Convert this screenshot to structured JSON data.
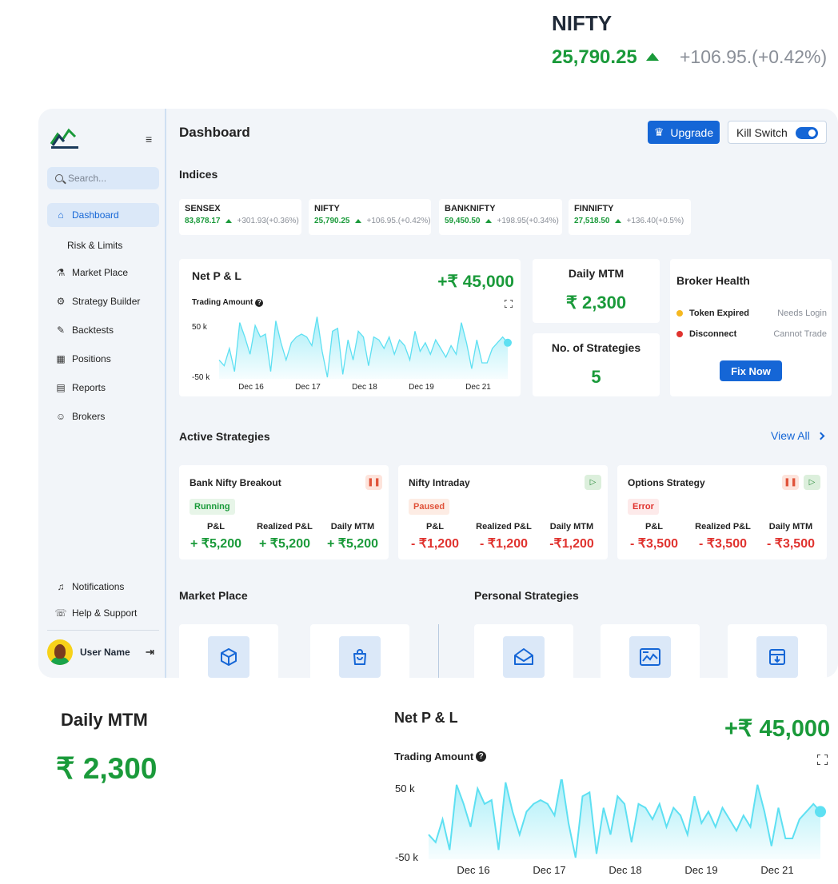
{
  "float_nifty": {
    "title": "NIFTY",
    "value": "25,790.25",
    "change": "+106.95.(+0.42%)"
  },
  "sidebar": {
    "search_placeholder": "Search...",
    "items": [
      {
        "label": "Dashboard",
        "icon": "home-icon"
      },
      {
        "label": "Risk & Limits",
        "icon": ""
      },
      {
        "label": "Market Place",
        "icon": "market-icon"
      },
      {
        "label": "Strategy Builder",
        "icon": "strategy-icon"
      },
      {
        "label": "Backtests",
        "icon": "backtest-icon"
      },
      {
        "label": "Positions",
        "icon": "positions-icon"
      },
      {
        "label": "Reports",
        "icon": "reports-icon"
      },
      {
        "label": "Brokers",
        "icon": "brokers-icon"
      }
    ],
    "notifications": "Notifications",
    "help": "Help & Support",
    "user_name": "User Name"
  },
  "header": {
    "title": "Dashboard",
    "upgrade": "Upgrade",
    "kill_switch": "Kill Switch"
  },
  "indices": {
    "title": "Indices",
    "items": [
      {
        "name": "SENSEX",
        "value": "83,878.17",
        "change": "+301.93(+0.36%)"
      },
      {
        "name": "NIFTY",
        "value": "25,790.25",
        "change": "+106.95.(+0.42%)"
      },
      {
        "name": "BANKNIFTY",
        "value": "59,450.50",
        "change": "+198.95(+0.34%)"
      },
      {
        "name": "FINNIFTY",
        "value": "27,518.50",
        "change": "+136.40(+0.5%)"
      }
    ]
  },
  "pnl": {
    "title": "Net P & L",
    "amount": "+₹ 45,000",
    "trading_amount": "Trading Amount",
    "y_labels": [
      "50 k",
      "-50 k"
    ],
    "x_labels": [
      "Dec 16",
      "Dec 17",
      "Dec 18",
      "Dec 19",
      "Dec 21"
    ]
  },
  "daily_mtm": {
    "title": "Daily MTM",
    "value": "₹ 2,300"
  },
  "strategies_count": {
    "title": "No. of Strategies",
    "value": "5"
  },
  "broker_health": {
    "title": "Broker Health",
    "rows": [
      {
        "label": "Token Expired",
        "status": "Needs Login",
        "color": "#f5b820"
      },
      {
        "label": "Disconnect",
        "status": "Cannot Trade",
        "color": "#e0332f"
      }
    ],
    "fix": "Fix Now"
  },
  "active_strategies": {
    "title": "Active Strategies",
    "view_all": "View All",
    "columns": [
      "P&L",
      "Realized P&L",
      "Daily MTM"
    ],
    "items": [
      {
        "name": "Bank Nifty Breakout",
        "status": "Running",
        "pnl": "+ ₹5,200",
        "realized": "+ ₹5,200",
        "mtm": "+ ₹5,200"
      },
      {
        "name": "Nifty Intraday",
        "status": "Paused",
        "pnl": "- ₹1,200",
        "realized": "- ₹1,200",
        "mtm": "-₹1,200"
      },
      {
        "name": "Options Strategy",
        "status": "Error",
        "pnl": "- ₹3,500",
        "realized": "- ₹3,500",
        "mtm": "- ₹3,500"
      }
    ]
  },
  "market_place": {
    "title": "Market Place"
  },
  "personal_strategies": {
    "title": "Personal Strategies"
  },
  "colors": {
    "accent": "#1566d6",
    "positive": "#1a9a3a",
    "negative": "#e0332f",
    "chart_line": "#5ee0f2"
  },
  "chart_data": {
    "type": "area",
    "title": "Net P & L",
    "ylabel": "",
    "xlabel": "",
    "ylim": [
      -50000,
      50000
    ],
    "x_ticks": [
      "Dec 16",
      "Dec 17",
      "Dec 18",
      "Dec 19",
      "Dec 21"
    ],
    "series": [
      {
        "values": [
          -20000,
          -30000,
          0,
          -40000,
          45000,
          20000,
          -10000,
          40000,
          20000,
          25000,
          -40000,
          48000,
          10000,
          -20000,
          10000,
          20000,
          25000,
          20000,
          5000,
          55000,
          -5000,
          -50000,
          30000,
          35000,
          -45000,
          15000,
          -20000,
          30000,
          20000,
          -30000,
          20000,
          15000,
          0,
          20000,
          -10000,
          15000,
          5000,
          -20000,
          30000,
          -5000,
          10000,
          -10000,
          15000,
          0,
          -15000,
          5000,
          -10000,
          45000,
          10000,
          -35000,
          15000,
          -25000,
          -25000,
          0,
          10000,
          20000,
          10000
        ]
      }
    ]
  }
}
